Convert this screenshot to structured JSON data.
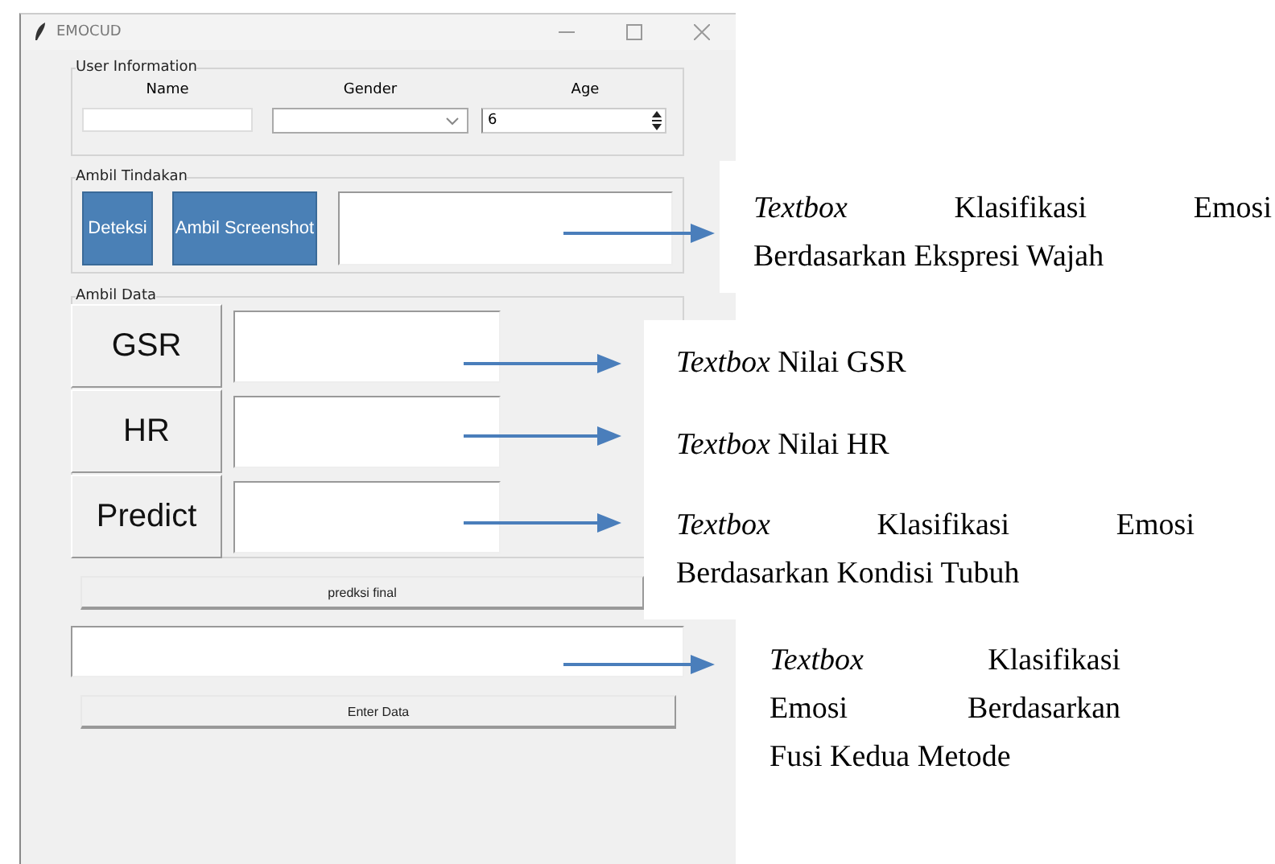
{
  "window": {
    "title": "EMOCUD"
  },
  "user_information": {
    "title": "User Information",
    "fields": [
      {
        "label": "Name",
        "kind": "entry"
      },
      {
        "label": "Gender",
        "kind": "combobox"
      },
      {
        "label": "Age",
        "kind": "spinbox",
        "value": "6"
      }
    ]
  },
  "ambil_tindakan": {
    "title": "Ambil Tindakan",
    "buttons": [
      "Deteksi",
      "Ambil Screenshot"
    ]
  },
  "ambil_data": {
    "title": "Ambil Data",
    "rows": [
      "GSR",
      "HR",
      "Predict"
    ]
  },
  "final_prediction_button": "predksi final",
  "enter_data_button": "Enter Data",
  "annotations": [
    {
      "lines": [
        "*Textbox* Klasifikasi Emosi",
        "Berdasarkan Ekspresi Wajah"
      ]
    },
    {
      "lines": [
        "*Textbox* Nilai GSR"
      ]
    },
    {
      "lines": [
        "*Textbox* Nilai HR"
      ]
    },
    {
      "lines": [
        "*Textbox* Klasifikasi Emosi",
        "Berdasarkan Kondisi Tubuh"
      ]
    },
    {
      "lines": [
        "*Textbox* Klasifikasi",
        "Emosi Berdasarkan",
        "Fusi Kedua Metode"
      ]
    }
  ]
}
